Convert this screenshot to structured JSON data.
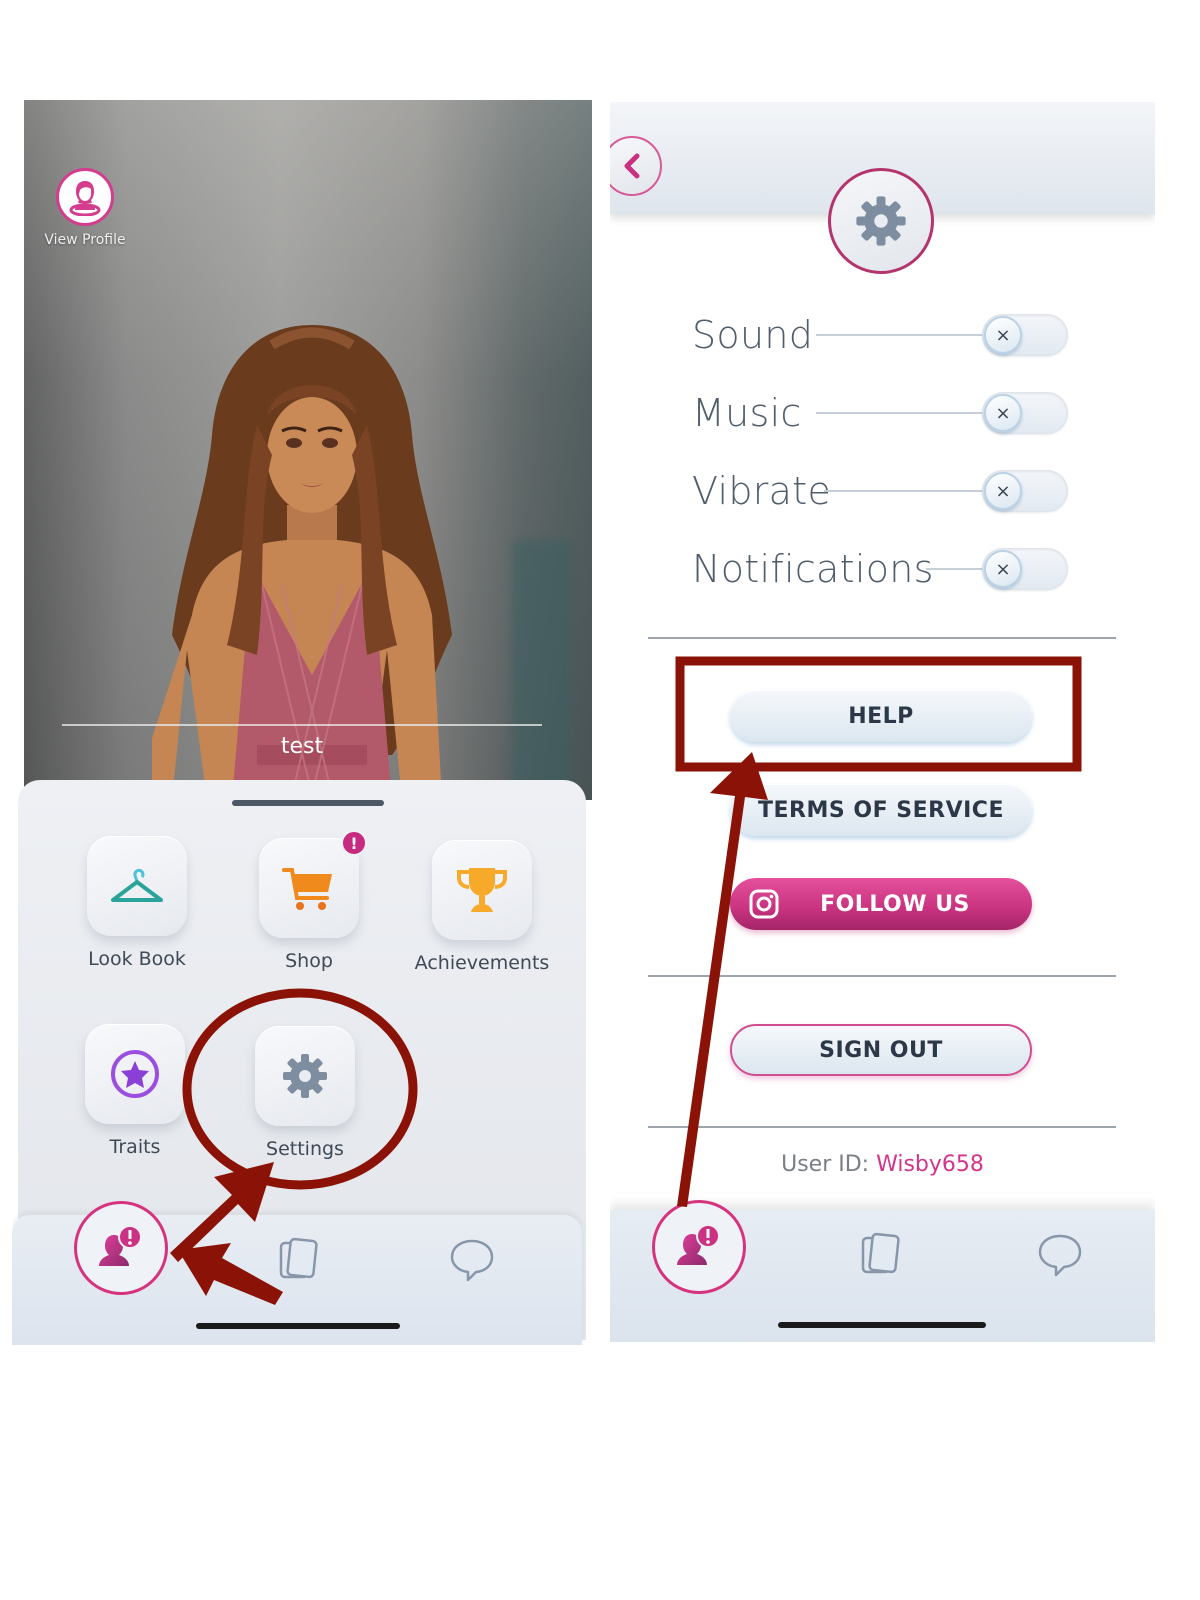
{
  "left_screen": {
    "view_profile_label": "View Profile",
    "avatar_name": "test",
    "menu": [
      {
        "label": "Look Book",
        "icon": "hanger-icon",
        "color": "#2aa39a"
      },
      {
        "label": "Shop",
        "icon": "cart-icon",
        "color": "#f08a1c",
        "badge": "!"
      },
      {
        "label": "Achievements",
        "icon": "trophy-icon",
        "color": "#f7a92a"
      },
      {
        "label": "Traits",
        "icon": "star-badge-icon",
        "color": "#9b4fe0"
      },
      {
        "label": "Settings",
        "icon": "gear-icon",
        "color": "#7e8da0"
      }
    ],
    "tabbar": {
      "profile_badge": "!",
      "tabs": [
        "profile-tab",
        "stories-tab",
        "chat-tab"
      ]
    }
  },
  "right_screen": {
    "back_icon": "chevron-left-icon",
    "header_icon": "gear-icon",
    "settings": [
      {
        "label": "Sound",
        "enabled": false,
        "toggle_symbol": "×"
      },
      {
        "label": "Music",
        "enabled": false,
        "toggle_symbol": "×"
      },
      {
        "label": "Vibrate",
        "enabled": false,
        "toggle_symbol": "×"
      },
      {
        "label": "Notifications",
        "enabled": false,
        "toggle_symbol": "×"
      }
    ],
    "buttons": {
      "help": "HELP",
      "terms": "TERMS OF SERVICE",
      "follow": "FOLLOW US",
      "sign_out": "SIGN OUT"
    },
    "user_id_label": "User ID:",
    "user_id_value": "Wisby658",
    "tabbar": {
      "profile_badge": "!"
    }
  },
  "colors": {
    "accent_pink": "#d6337f",
    "annotation_red": "#8a1206",
    "text_dark": "#2c3847"
  }
}
